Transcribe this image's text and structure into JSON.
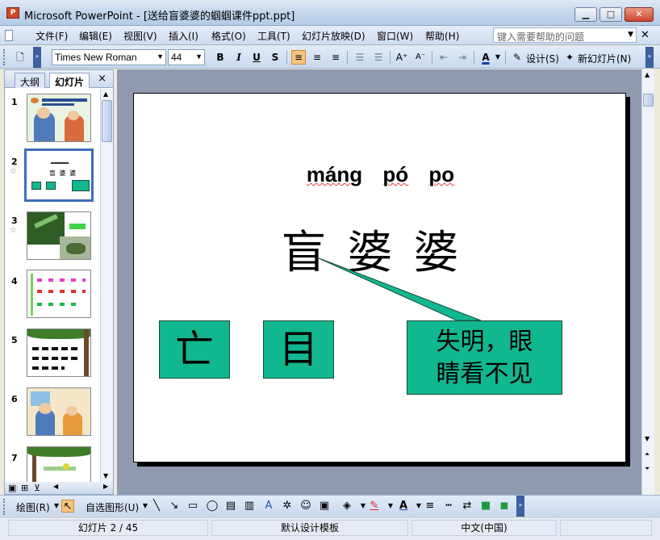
{
  "window": {
    "title": "Microsoft PowerPoint - [送给盲婆婆的蝈蝈课件ppt.ppt]",
    "app_icon_label": "P"
  },
  "menu": {
    "items": [
      "文件(F)",
      "编辑(E)",
      "视图(V)",
      "插入(I)",
      "格式(O)",
      "工具(T)",
      "幻灯片放映(D)",
      "窗口(W)",
      "帮助(H)"
    ],
    "help_placeholder": "键入需要帮助的问题"
  },
  "format_toolbar": {
    "font": "Times New Roman",
    "size": "44",
    "bold": "B",
    "italic": "I",
    "underline": "U",
    "shadow": "S",
    "design_label": "设计(S)",
    "new_slide_label": "新幻灯片(N)"
  },
  "left_pane": {
    "tab_outline": "大纲",
    "tab_slides": "幻灯片",
    "close": "×",
    "slides": [
      {
        "num": "1",
        "star": ""
      },
      {
        "num": "2",
        "star": "☆"
      },
      {
        "num": "3",
        "star": "☆"
      },
      {
        "num": "4",
        "star": ""
      },
      {
        "num": "5",
        "star": ""
      },
      {
        "num": "6",
        "star": ""
      },
      {
        "num": "7",
        "star": ""
      }
    ],
    "selected_slide": 2
  },
  "slide": {
    "pinyin": [
      "máng",
      "pó",
      "po"
    ],
    "hanzi": "盲婆婆",
    "box_left": "亡",
    "box_middle": "目",
    "callout_line1": "失明，眼",
    "callout_line2": "睛看不见",
    "accent_color": "#11b78f"
  },
  "draw_toolbar": {
    "draw_label": "绘图(R)",
    "autoshape_label": "自选图形(U)"
  },
  "status": {
    "slide_info": "幻灯片 2 / 45",
    "template": "默认设计模板",
    "language": "中文(中国)"
  }
}
